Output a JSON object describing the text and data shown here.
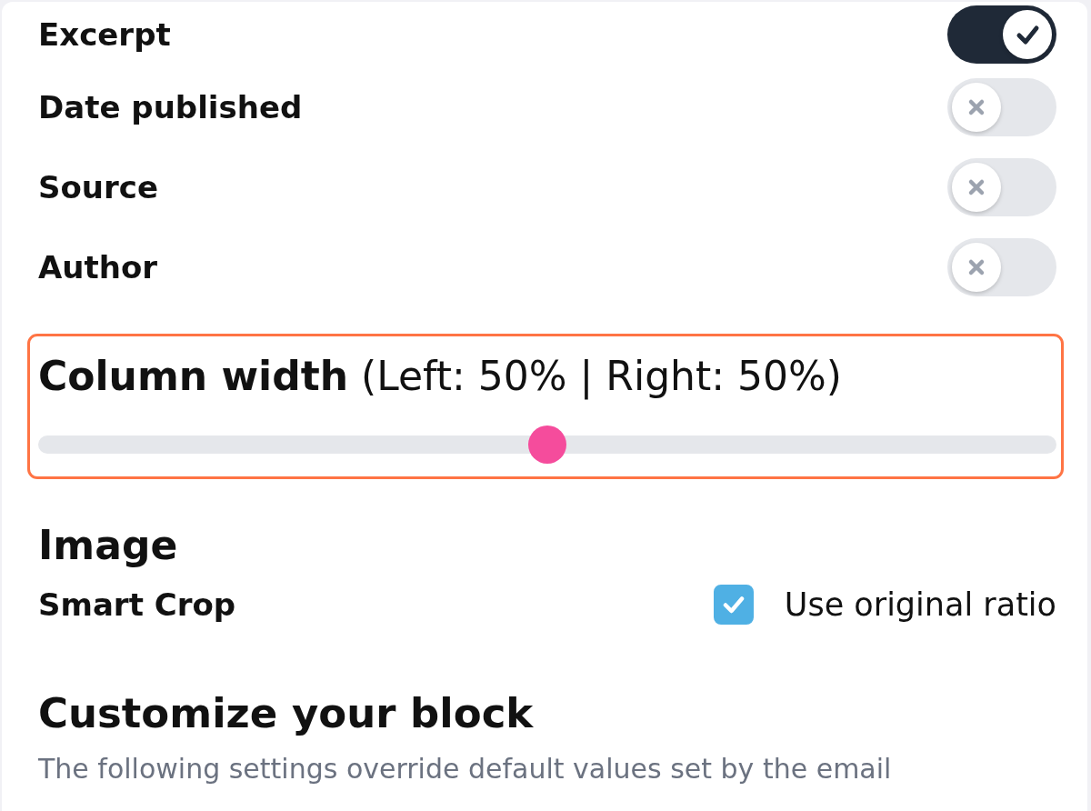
{
  "toggles": [
    {
      "label": "Excerpt",
      "on": true
    },
    {
      "label": "Date published",
      "on": false
    },
    {
      "label": "Source",
      "on": false
    },
    {
      "label": "Author",
      "on": false
    }
  ],
  "column_width": {
    "label": "**Column width** (Left: 50% | Right: 50%)",
    "level": 0.5,
    "highlighted": true
  },
  "image": {
    "heading": "Image",
    "smart_crop_label": "Smart Crop",
    "original_ratio": {
      "label": "Use original ratio",
      "checked": true
    }
  },
  "customize": {
    "heading": "Customize your block",
    "description": "The following settings override default values set by the email"
  }
}
